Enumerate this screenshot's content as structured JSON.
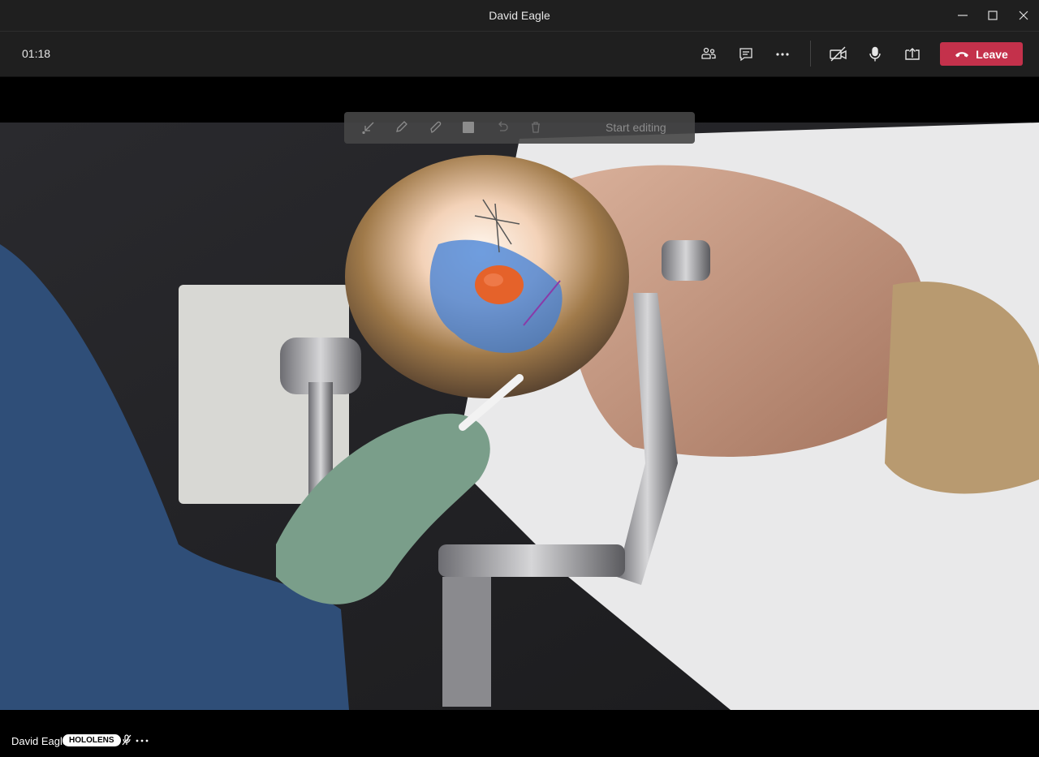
{
  "window": {
    "title": "David Eagle"
  },
  "call": {
    "timer": "01:18",
    "leave_label": "Leave"
  },
  "toolbar_icons": [
    "people-icon",
    "chat-icon",
    "more-icon",
    "camera-off-icon",
    "microphone-icon",
    "share-screen-icon"
  ],
  "annotation_bar": {
    "start_editing_label": "Start editing",
    "tools": [
      "arrow-icon",
      "pen-icon",
      "highlighter-icon",
      "color-square-icon",
      "undo-icon",
      "delete-icon"
    ]
  },
  "participant": {
    "name": "David Eagle",
    "badge": "HOLOLENS"
  },
  "colors": {
    "leave": "#c4314b",
    "chrome": "#1f1f1f",
    "ar_overlay": "#3f7fd8",
    "ar_object": "#e5622a"
  }
}
